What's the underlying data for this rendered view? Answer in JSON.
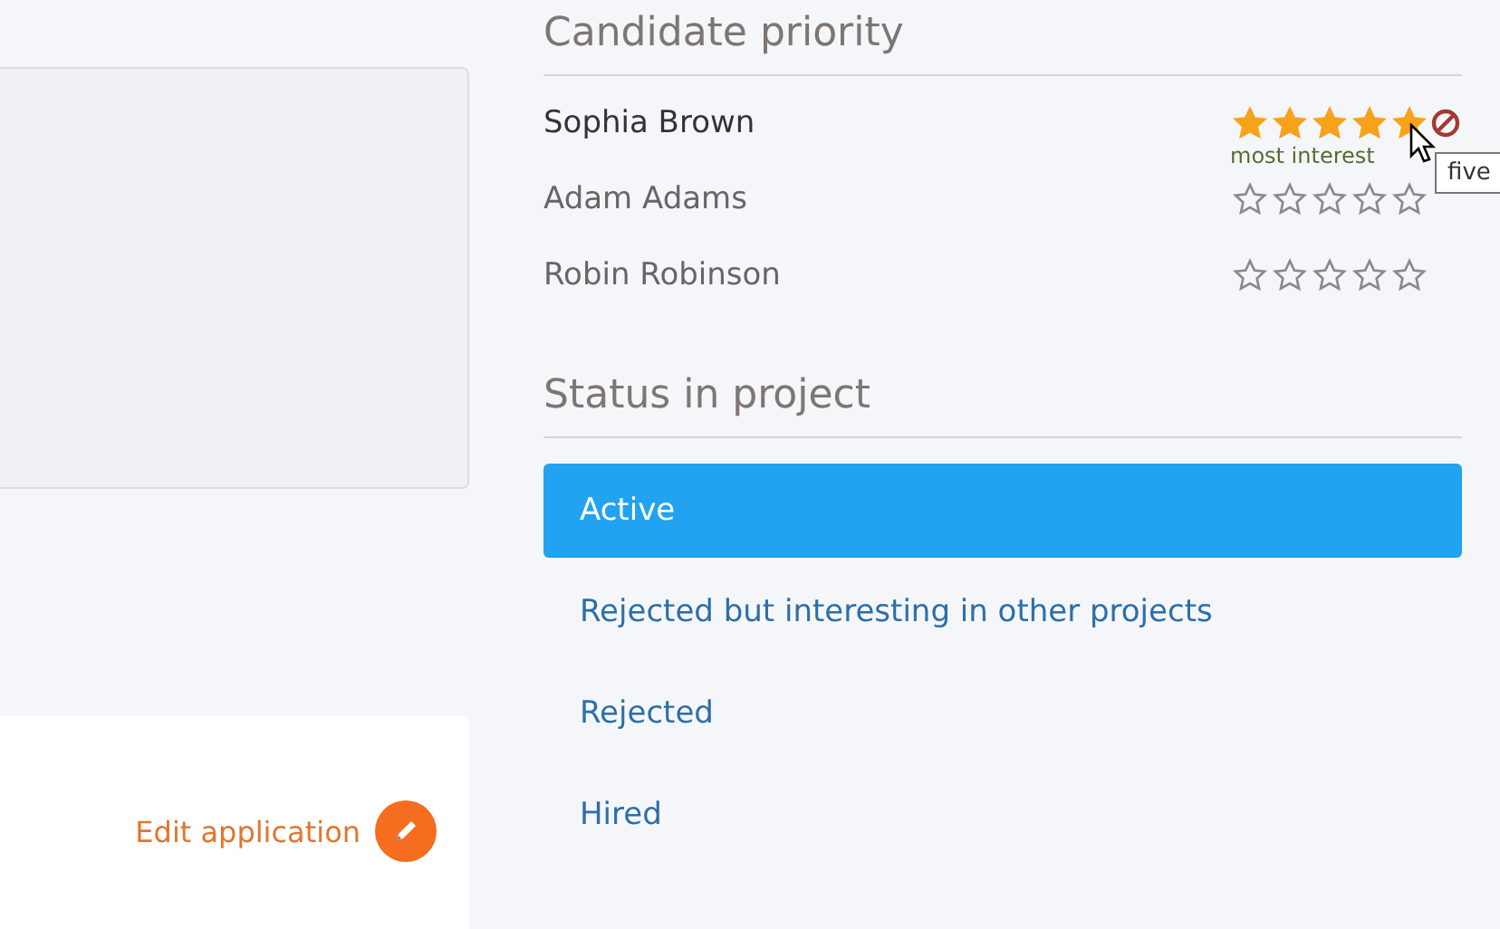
{
  "candidate_priority": {
    "title": "Candidate priority",
    "candidates": [
      {
        "name": "Sophia Brown",
        "stars": 5,
        "caption": "most interest",
        "tooltip": "five"
      },
      {
        "name": "Adam Adams",
        "stars": 0
      },
      {
        "name": "Robin Robinson",
        "stars": 0
      }
    ]
  },
  "status": {
    "title": "Status in project",
    "options": [
      {
        "label": "Active",
        "selected": true
      },
      {
        "label": "Rejected but interesting in other projects",
        "selected": false
      },
      {
        "label": "Rejected",
        "selected": false
      },
      {
        "label": "Hired",
        "selected": false
      }
    ]
  },
  "edit_link": "Edit application"
}
